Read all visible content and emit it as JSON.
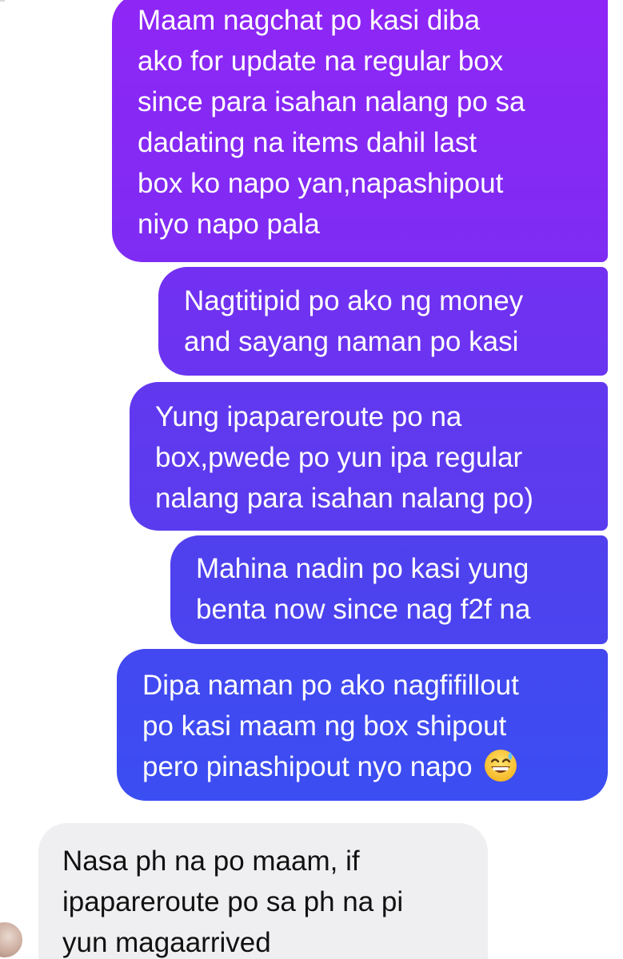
{
  "conversation": {
    "outgoing": [
      {
        "lines": [
          "Maam nagchat po kasi diba",
          "ako for update na regular box",
          "since para isahan nalang po sa",
          "dadating na items dahil last",
          "box ko napo yan,napashipout",
          "niyo napo pala"
        ]
      },
      {
        "lines": [
          "Nagtitipid po ako ng money",
          "and sayang naman po kasi"
        ]
      },
      {
        "lines": [
          "Yung ipapareroute po na",
          "box,pwede po yun ipa regular",
          "nalang para isahan nalang po)"
        ]
      },
      {
        "lines": [
          "Mahina nadin po kasi yung",
          "benta now since nag f2f na"
        ]
      },
      {
        "lines": [
          "Dipa naman po ako nagfifillout",
          "po kasi maam ng box shipout",
          "pero pinashipout nyo napo"
        ],
        "emoji": "grinning-sweat-emoji"
      }
    ],
    "incoming": [
      {
        "lines": [
          "Nasa ph na po maam, if",
          "ipapareroute po sa ph na pi",
          "yun magaarrived"
        ]
      }
    ]
  },
  "colors": {
    "outgoing_top": "#8f26f6",
    "outgoing_bottom": "#3b4ef2",
    "incoming_bg": "#efeff1",
    "incoming_text": "#111111",
    "outgoing_text": "#ffffff"
  }
}
